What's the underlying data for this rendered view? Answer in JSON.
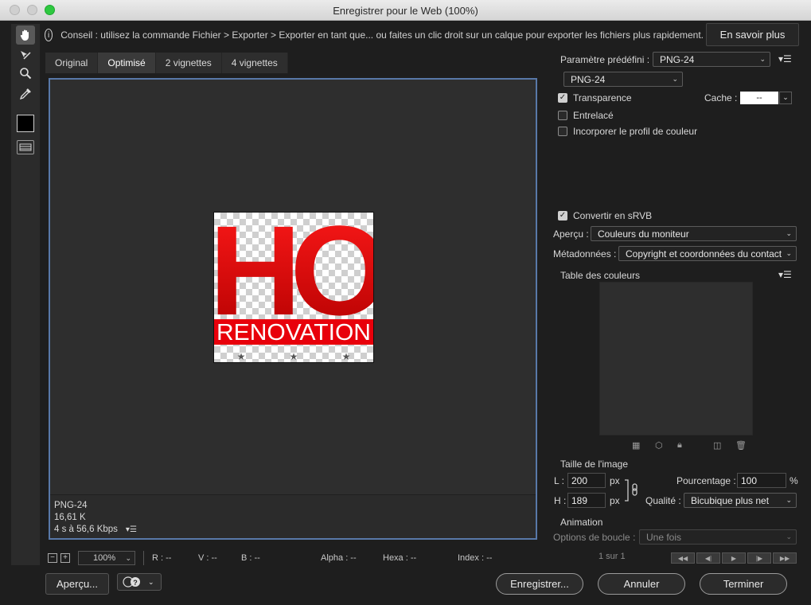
{
  "window": {
    "title": "Enregistrer pour le Web (100%)"
  },
  "tip": {
    "text": "Conseil : utilisez la commande Fichier > Exporter > Exporter en tant que... ou faites un clic droit sur un calque pour exporter les fichiers plus rapidement.",
    "learn_more": "En savoir plus"
  },
  "tabs": [
    "Original",
    "Optimisé",
    "2 vignettes",
    "4 vignettes"
  ],
  "preview": {
    "format": "PNG-24",
    "size": "16,61 K",
    "time": "4 s à 56,6 Kbps",
    "logo_text": "RENOVATION",
    "logo_letters": "HO"
  },
  "statusbar": {
    "zoom": "100%",
    "r": "R : --",
    "v": "V : --",
    "b": "B : --",
    "alpha": "Alpha : --",
    "hexa": "Hexa : --",
    "index": "Index : --"
  },
  "bottom": {
    "preview_btn": "Aperçu...",
    "save_btn": "Enregistrer...",
    "cancel_btn": "Annuler",
    "done_btn": "Terminer"
  },
  "settings": {
    "preset_label": "Paramètre prédéfini :",
    "preset_value": "PNG-24",
    "format_value": "PNG-24",
    "transparency": "Transparence",
    "matte_label": "Cache :",
    "matte_value": "--",
    "interlaced": "Entrelacé",
    "embed_profile": "Incorporer le profil de couleur",
    "convert_srgb": "Convertir en sRVB",
    "preview_label": "Aperçu :",
    "preview_value": "Couleurs du moniteur",
    "metadata_label": "Métadonnées :",
    "metadata_value": "Copyright et coordonnées du contact",
    "color_table": "Table des couleurs",
    "image_size": "Taille de l'image",
    "width_label": "L :",
    "width_value": "200",
    "height_label": "H :",
    "height_value": "189",
    "px": "px",
    "percent_label": "Pourcentage :",
    "percent_value": "100",
    "percent_unit": "%",
    "quality_label": "Qualité :",
    "quality_value": "Bicubique plus net",
    "animation": "Animation",
    "loop_label": "Options de boucle :",
    "loop_value": "Une fois",
    "frame_counter": "1 sur 1"
  },
  "colors": {
    "accent_border": "#5878a8",
    "logo_red": "#e8000b"
  }
}
